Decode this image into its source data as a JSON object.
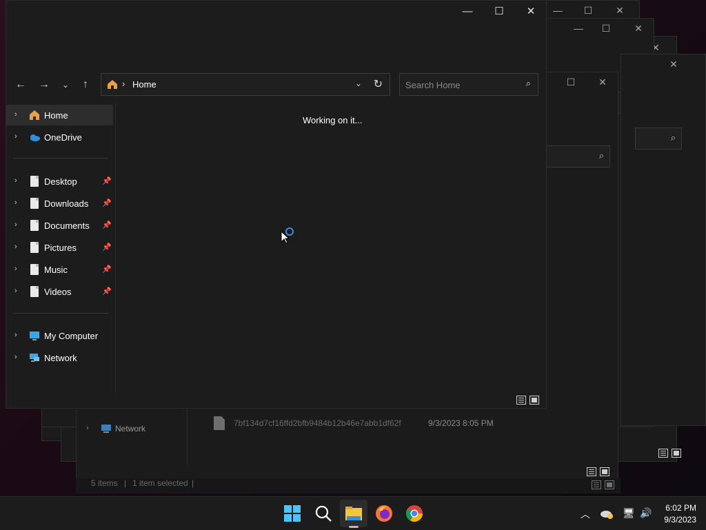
{
  "main_window": {
    "address": {
      "crumb": "Home"
    },
    "search": {
      "placeholder": "Search Home"
    },
    "status_text": "Working on it...",
    "sidebar": [
      {
        "label": "Home",
        "icon": "home-icon",
        "pinned": false
      },
      {
        "label": "OneDrive",
        "icon": "cloud-icon",
        "pinned": false
      },
      {
        "label": "Desktop",
        "icon": "document-icon",
        "pinned": true
      },
      {
        "label": "Downloads",
        "icon": "document-icon",
        "pinned": true
      },
      {
        "label": "Documents",
        "icon": "document-icon",
        "pinned": true
      },
      {
        "label": "Pictures",
        "icon": "document-icon",
        "pinned": true
      },
      {
        "label": "Music",
        "icon": "document-icon",
        "pinned": true
      },
      {
        "label": "Videos",
        "icon": "document-icon",
        "pinned": true
      },
      {
        "label": "My Computer",
        "icon": "computer-icon",
        "pinned": false
      },
      {
        "label": "Network",
        "icon": "network-icon",
        "pinned": false
      }
    ]
  },
  "background_window": {
    "network_label": "Network",
    "file_name": "7bf134d7cf16ffd2bfb9484b12b46e7abb1df62f",
    "file_date": "9/3/2023 8:05 PM",
    "status_items": "5 items",
    "status_selected": "1 item selected"
  },
  "taskbar": {
    "apps": [
      "start-icon",
      "search-icon",
      "file-explorer-icon",
      "firefox-icon",
      "chrome-icon"
    ],
    "time": "6:02 PM",
    "date": "9/3/2023"
  },
  "colors": {
    "accent": "#3c8de0",
    "window_bg": "#1c1c1c",
    "selected_bg": "#2d2d2d"
  }
}
